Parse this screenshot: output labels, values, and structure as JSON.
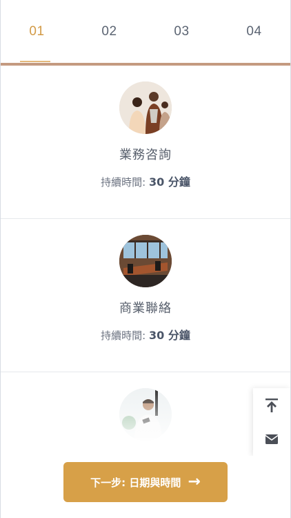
{
  "steps": [
    {
      "label": "01",
      "active": true
    },
    {
      "label": "02",
      "active": false
    },
    {
      "label": "03",
      "active": false
    },
    {
      "label": "04",
      "active": false
    }
  ],
  "services": [
    {
      "name": "業務咨詢",
      "duration_label": "持續時間:",
      "duration_value": "30 分鐘",
      "icon": "team-meeting-photo"
    },
    {
      "name": "商業聯絡",
      "duration_label": "持續時間:",
      "duration_value": "30 分鐘",
      "icon": "conference-room-photo"
    },
    {
      "name": "",
      "duration_label": "",
      "duration_value": "",
      "icon": "man-with-phone-photo"
    }
  ],
  "floating": {
    "top_icon": "arrow-up-to-line-icon",
    "mail_icon": "mail-icon"
  },
  "cta": {
    "label": "下一步: 日期與時間",
    "arrow": "→"
  },
  "colors": {
    "accent": "#d7a048",
    "active_step": "#d29a45",
    "rule": "#c49a80"
  }
}
